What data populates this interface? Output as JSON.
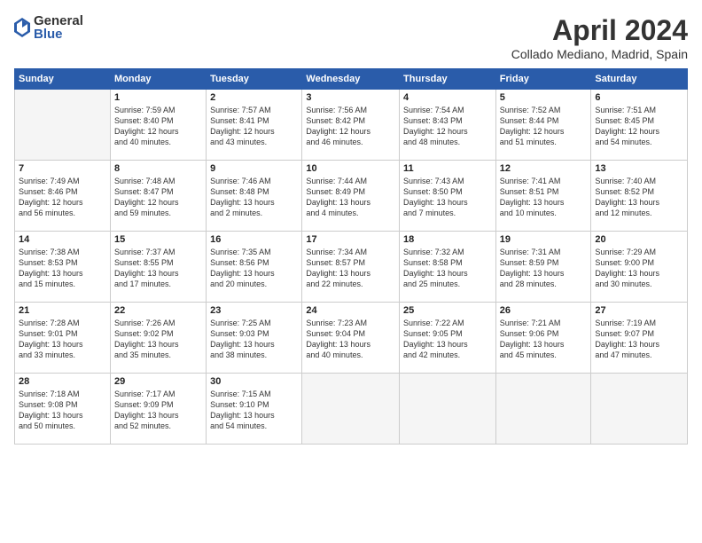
{
  "logo": {
    "general": "General",
    "blue": "Blue"
  },
  "header": {
    "month": "April 2024",
    "location": "Collado Mediano, Madrid, Spain"
  },
  "weekdays": [
    "Sunday",
    "Monday",
    "Tuesday",
    "Wednesday",
    "Thursday",
    "Friday",
    "Saturday"
  ],
  "weeks": [
    [
      {
        "day": "",
        "info": ""
      },
      {
        "day": "1",
        "info": "Sunrise: 7:59 AM\nSunset: 8:40 PM\nDaylight: 12 hours\nand 40 minutes."
      },
      {
        "day": "2",
        "info": "Sunrise: 7:57 AM\nSunset: 8:41 PM\nDaylight: 12 hours\nand 43 minutes."
      },
      {
        "day": "3",
        "info": "Sunrise: 7:56 AM\nSunset: 8:42 PM\nDaylight: 12 hours\nand 46 minutes."
      },
      {
        "day": "4",
        "info": "Sunrise: 7:54 AM\nSunset: 8:43 PM\nDaylight: 12 hours\nand 48 minutes."
      },
      {
        "day": "5",
        "info": "Sunrise: 7:52 AM\nSunset: 8:44 PM\nDaylight: 12 hours\nand 51 minutes."
      },
      {
        "day": "6",
        "info": "Sunrise: 7:51 AM\nSunset: 8:45 PM\nDaylight: 12 hours\nand 54 minutes."
      }
    ],
    [
      {
        "day": "7",
        "info": "Sunrise: 7:49 AM\nSunset: 8:46 PM\nDaylight: 12 hours\nand 56 minutes."
      },
      {
        "day": "8",
        "info": "Sunrise: 7:48 AM\nSunset: 8:47 PM\nDaylight: 12 hours\nand 59 minutes."
      },
      {
        "day": "9",
        "info": "Sunrise: 7:46 AM\nSunset: 8:48 PM\nDaylight: 13 hours\nand 2 minutes."
      },
      {
        "day": "10",
        "info": "Sunrise: 7:44 AM\nSunset: 8:49 PM\nDaylight: 13 hours\nand 4 minutes."
      },
      {
        "day": "11",
        "info": "Sunrise: 7:43 AM\nSunset: 8:50 PM\nDaylight: 13 hours\nand 7 minutes."
      },
      {
        "day": "12",
        "info": "Sunrise: 7:41 AM\nSunset: 8:51 PM\nDaylight: 13 hours\nand 10 minutes."
      },
      {
        "day": "13",
        "info": "Sunrise: 7:40 AM\nSunset: 8:52 PM\nDaylight: 13 hours\nand 12 minutes."
      }
    ],
    [
      {
        "day": "14",
        "info": "Sunrise: 7:38 AM\nSunset: 8:53 PM\nDaylight: 13 hours\nand 15 minutes."
      },
      {
        "day": "15",
        "info": "Sunrise: 7:37 AM\nSunset: 8:55 PM\nDaylight: 13 hours\nand 17 minutes."
      },
      {
        "day": "16",
        "info": "Sunrise: 7:35 AM\nSunset: 8:56 PM\nDaylight: 13 hours\nand 20 minutes."
      },
      {
        "day": "17",
        "info": "Sunrise: 7:34 AM\nSunset: 8:57 PM\nDaylight: 13 hours\nand 22 minutes."
      },
      {
        "day": "18",
        "info": "Sunrise: 7:32 AM\nSunset: 8:58 PM\nDaylight: 13 hours\nand 25 minutes."
      },
      {
        "day": "19",
        "info": "Sunrise: 7:31 AM\nSunset: 8:59 PM\nDaylight: 13 hours\nand 28 minutes."
      },
      {
        "day": "20",
        "info": "Sunrise: 7:29 AM\nSunset: 9:00 PM\nDaylight: 13 hours\nand 30 minutes."
      }
    ],
    [
      {
        "day": "21",
        "info": "Sunrise: 7:28 AM\nSunset: 9:01 PM\nDaylight: 13 hours\nand 33 minutes."
      },
      {
        "day": "22",
        "info": "Sunrise: 7:26 AM\nSunset: 9:02 PM\nDaylight: 13 hours\nand 35 minutes."
      },
      {
        "day": "23",
        "info": "Sunrise: 7:25 AM\nSunset: 9:03 PM\nDaylight: 13 hours\nand 38 minutes."
      },
      {
        "day": "24",
        "info": "Sunrise: 7:23 AM\nSunset: 9:04 PM\nDaylight: 13 hours\nand 40 minutes."
      },
      {
        "day": "25",
        "info": "Sunrise: 7:22 AM\nSunset: 9:05 PM\nDaylight: 13 hours\nand 42 minutes."
      },
      {
        "day": "26",
        "info": "Sunrise: 7:21 AM\nSunset: 9:06 PM\nDaylight: 13 hours\nand 45 minutes."
      },
      {
        "day": "27",
        "info": "Sunrise: 7:19 AM\nSunset: 9:07 PM\nDaylight: 13 hours\nand 47 minutes."
      }
    ],
    [
      {
        "day": "28",
        "info": "Sunrise: 7:18 AM\nSunset: 9:08 PM\nDaylight: 13 hours\nand 50 minutes."
      },
      {
        "day": "29",
        "info": "Sunrise: 7:17 AM\nSunset: 9:09 PM\nDaylight: 13 hours\nand 52 minutes."
      },
      {
        "day": "30",
        "info": "Sunrise: 7:15 AM\nSunset: 9:10 PM\nDaylight: 13 hours\nand 54 minutes."
      },
      {
        "day": "",
        "info": ""
      },
      {
        "day": "",
        "info": ""
      },
      {
        "day": "",
        "info": ""
      },
      {
        "day": "",
        "info": ""
      }
    ]
  ]
}
